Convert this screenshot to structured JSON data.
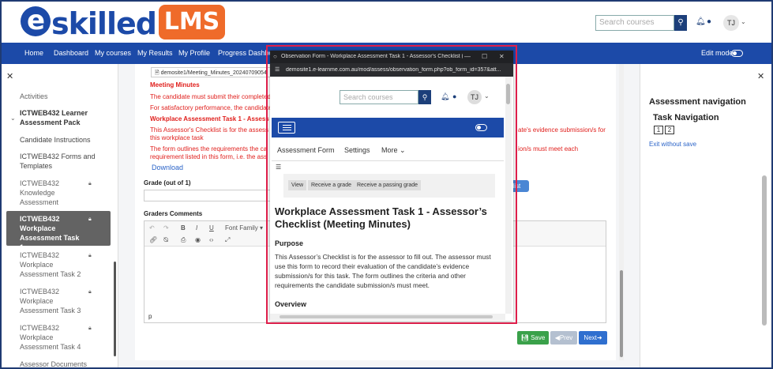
{
  "header": {
    "logo_text": "skilled",
    "logo_e": "e",
    "logo_lms": "LMS",
    "search_placeholder": "Search courses",
    "avatar_initials": "TJ"
  },
  "nav": {
    "items": [
      "Home",
      "Dashboard",
      "My courses",
      "My Results",
      "My Profile",
      "Progress Dashboa"
    ],
    "edit_mode": "Edit mode"
  },
  "sidebar": {
    "items": [
      "Activities",
      "ICTWEB432 Learner Assessment Pack",
      "Candidate Instructions",
      "ICTWEB432 Forms and Templates",
      "ICTWEB432 Knowledge Assessment",
      "ICTWEB432 Workplace Assessment Task 1",
      "ICTWEB432 Workplace Assessment Task 2",
      "ICTWEB432 Workplace Assessment Task 3",
      "ICTWEB432 Workplace Assessment Task 4",
      "Assessor Documents"
    ]
  },
  "main": {
    "file_name": "demosite1/Meeting_Minutes_20240709054",
    "meeting_minutes": "Meeting Minutes",
    "line1": "The candidate must submit their completed",
    "line2": "For satisfactory performance, the candidate",
    "task_heading": "Workplace Assessment Task 1 - Assess",
    "line3a": "This Assessor's Checklist is for the assess",
    "line3b": "this workplace task",
    "line3r": "ate's evidence submission/s for",
    "line4a": "The form outlines the requirements the ca",
    "line4b": "requirement listed in this form, i.e. the ass",
    "line4r": "ion/s must meet each",
    "download": "Download",
    "grade_label": "Grade (out of 1)",
    "checklist_btn": "dist",
    "graders_label": "Graders Comments",
    "font_family": "Font Family",
    "editor_p": "p",
    "save": "Save",
    "prev": "Prev",
    "next": "Next"
  },
  "right_drawer": {
    "title": "Assessment navigation",
    "subtitle": "Task Navigation",
    "boxes": [
      "1",
      "2"
    ],
    "exit": "Exit without save"
  },
  "popup": {
    "window_title": "Observation Form - Workplace Assessment Task 1 - Assessor's Checklist (Meeting...",
    "url": "demosite1.e-learnme.com.au/mod/assess/observation_form.php?ob_form_id=357&att...",
    "search_placeholder": "Search courses",
    "avatar_initials": "TJ",
    "tabs": [
      "Assessment Form",
      "Settings",
      "More"
    ],
    "chips": [
      "View",
      "Receive a grade",
      "Receive a passing grade"
    ],
    "heading": "Workplace Assessment Task 1 - Assessor’s Checklist (Meeting Minutes)",
    "purpose_label": "Purpose",
    "purpose_text": "This Assessor’s Checklist is for the assessor to fill out. The assessor must use this form to record their evaluation of the candidate’s evidence submission/s for this task. The form outlines the criteria and other requirements the candidate submission/s must meet.",
    "overview_label": "Overview"
  }
}
